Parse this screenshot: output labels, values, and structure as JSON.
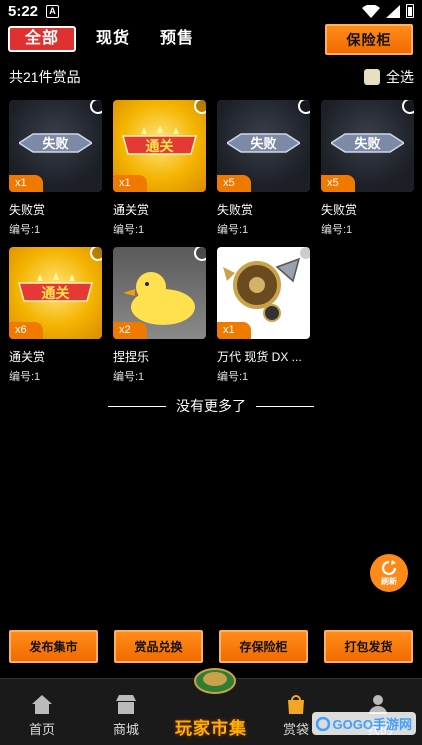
{
  "status_bar": {
    "time": "5:22"
  },
  "tabs": [
    {
      "label": "全部",
      "active": true
    },
    {
      "label": "现货",
      "active": false
    },
    {
      "label": "预售",
      "active": false
    }
  ],
  "safe_button": "保险柜",
  "summary": {
    "count_text": "共21件赏品",
    "select_all": "全选"
  },
  "items": [
    {
      "name": "失败赏",
      "code": "编号:1",
      "qty": "x1",
      "image": "fail-badge"
    },
    {
      "name": "通关赏",
      "code": "编号:1",
      "qty": "x1",
      "image": "pass-badge"
    },
    {
      "name": "失败赏",
      "code": "编号:1",
      "qty": "x5",
      "image": "fail-badge"
    },
    {
      "name": "失败赏",
      "code": "编号:1",
      "qty": "x5",
      "image": "fail-badge"
    },
    {
      "name": "通关赏",
      "code": "编号:1",
      "qty": "x6",
      "image": "pass-badge"
    },
    {
      "name": "捏捏乐",
      "code": "编号:1",
      "qty": "x2",
      "image": "duck-toy"
    },
    {
      "name": "万代 现货 DX ...",
      "code": "编号:1",
      "qty": "x1",
      "image": "dx-toy"
    }
  ],
  "badge_text": {
    "fail": "失败",
    "pass": "通关"
  },
  "no_more": "没有更多了",
  "refresh_label": "刷新",
  "actions": [
    "发布集市",
    "赏品兑换",
    "存保险柜",
    "打包发货"
  ],
  "bottom_nav": {
    "home": "首页",
    "mall": "商城",
    "center": "玩家市集",
    "bag": "赏袋",
    "mine": "我的"
  },
  "watermark": "GOGO手游网",
  "colors": {
    "accent": "#f26a00",
    "active_tab": "#e03131",
    "background": "#000000"
  }
}
